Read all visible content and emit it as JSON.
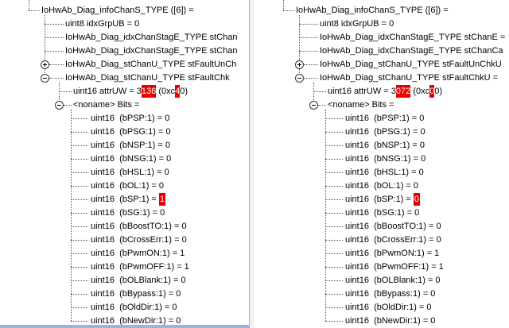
{
  "left": {
    "root": "IoHwAb_Diag_infoChanS_TYPE  ([6]) =",
    "grp": "uint8 idxGrpUB = 0",
    "stage1": "IoHwAb_Diag_idxChanStagE_TYPE stChan",
    "stage2": "IoHwAb_Diag_idxChanStagE_TYPE stChan",
    "unc": "IoHwAb_Diag_stChanU_TYPE stFaultUnCh",
    "chk": "IoHwAb_Diag_stChanU_TYPE stFaultChk",
    "attr": {
      "pre": "uint16 attrUW = 3",
      "hl1": "136",
      "mid": " (0xc",
      "hl2": "4",
      "post": "0)"
    },
    "noname": "<noname> Bits =",
    "bits": [
      {
        "pre": "uint16  (bPSP:1) = 0"
      },
      {
        "pre": "uint16  (bPSG:1) = 0"
      },
      {
        "pre": "uint16  (bNSP:1) = 0"
      },
      {
        "pre": "uint16  (bNSG:1) = 0"
      },
      {
        "pre": "uint16  (bHSL:1) = 0"
      },
      {
        "pre": "uint16  (bOL:1) = 0"
      },
      {
        "pre": "uint16  (bSP:1) = ",
        "hl": "1"
      },
      {
        "pre": "uint16  (bSG:1) = 0"
      },
      {
        "pre": "uint16  (bBoostTO:1) = 0"
      },
      {
        "pre": "uint16  (bCrossErr:1) = 0"
      },
      {
        "pre": "uint16  (bPwmON:1) = 1"
      },
      {
        "pre": "uint16  (bPwmOFF:1) = 1"
      },
      {
        "pre": "uint16  (bOLBlank:1) = 0"
      },
      {
        "pre": "uint16  (bBypass:1) = 0"
      },
      {
        "pre": "uint16  (bOldDir:1) = 0"
      },
      {
        "pre": "uint16  (bNewDir:1) = 0"
      }
    ]
  },
  "right": {
    "root": "IoHwAb_Diag_infoChanS_TYPE  ([6]) =",
    "grp": "uint8 idxGrpUB = 0",
    "stage1": "IoHwAb_Diag_idxChanStagE_TYPE stChanE =",
    "stage2": "IoHwAb_Diag_idxChanStagE_TYPE stChanCa",
    "unc": "IoHwAb_Diag_stChanU_TYPE stFaultUnChkU",
    "chk": "IoHwAb_Diag_stChanU_TYPE stFaultChkU =",
    "attr": {
      "pre": "uint16 attrUW = 3",
      "hl1": "072",
      "mid": " (0xc",
      "hl2": "0",
      "post": "0)"
    },
    "noname": "<noname> Bits =",
    "bits": [
      {
        "pre": "uint16  (bPSP:1) = 0"
      },
      {
        "pre": "uint16  (bPSG:1) = 0"
      },
      {
        "pre": "uint16  (bNSP:1) = 0"
      },
      {
        "pre": "uint16  (bNSG:1) = 0"
      },
      {
        "pre": "uint16  (bHSL:1) = 0"
      },
      {
        "pre": "uint16  (bOL:1) = 0"
      },
      {
        "pre": "uint16  (bSP:1) = ",
        "hl": "0"
      },
      {
        "pre": "uint16  (bSG:1) = 0"
      },
      {
        "pre": "uint16  (bBoostTO:1) = 0"
      },
      {
        "pre": "uint16  (bCrossErr:1) = 0"
      },
      {
        "pre": "uint16  (bPwmON:1) = 1"
      },
      {
        "pre": "uint16  (bPwmOFF:1) = 1"
      },
      {
        "pre": "uint16  (bOLBlank:1) = 0"
      },
      {
        "pre": "uint16  (bBypass:1) = 0"
      },
      {
        "pre": "uint16  (bOldDir:1) = 0"
      },
      {
        "pre": "uint16  (bNewDir:1) = 0"
      }
    ]
  }
}
